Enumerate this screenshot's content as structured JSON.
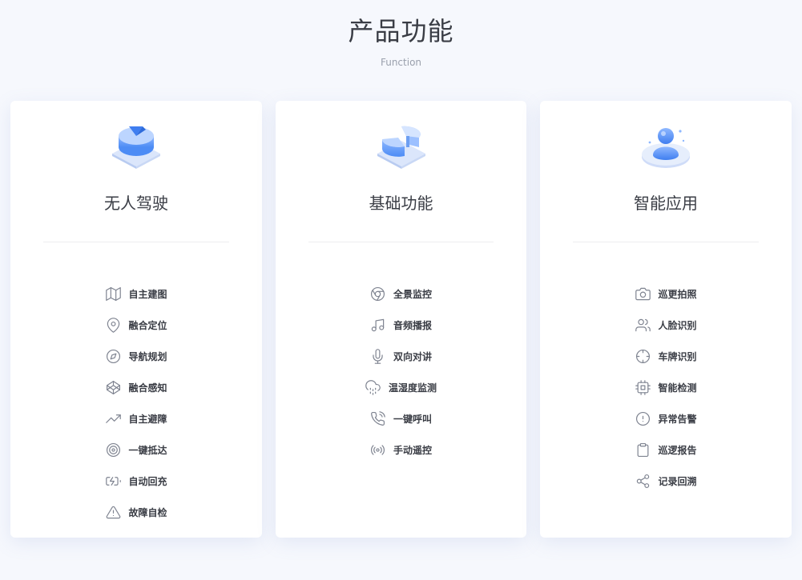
{
  "page": {
    "title": "产品功能",
    "subtitle": "Function"
  },
  "cards": [
    {
      "name": "无人驾驶",
      "icon": "isometric-cylinder-icon",
      "items": [
        {
          "label": "自主建图",
          "icon": "map-icon"
        },
        {
          "label": "融合定位",
          "icon": "location-pin-icon"
        },
        {
          "label": "导航规划",
          "icon": "compass-icon"
        },
        {
          "label": "融合感知",
          "icon": "codepen-icon"
        },
        {
          "label": "自主避障",
          "icon": "trending-up-icon"
        },
        {
          "label": "一键抵达",
          "icon": "target-icon"
        },
        {
          "label": "自动回充",
          "icon": "battery-charging-icon"
        },
        {
          "label": "故障自检",
          "icon": "warning-triangle-icon"
        }
      ]
    },
    {
      "name": "基础功能",
      "icon": "isometric-pie-chart-icon",
      "items": [
        {
          "label": "全景监控",
          "icon": "chrome-icon"
        },
        {
          "label": "音频播报",
          "icon": "music-icon"
        },
        {
          "label": "双向对讲",
          "icon": "microphone-icon"
        },
        {
          "label": "温湿度监测",
          "icon": "cloud-drizzle-icon"
        },
        {
          "label": "一键呼叫",
          "icon": "phone-call-icon"
        },
        {
          "label": "手动遥控",
          "icon": "radio-signal-icon"
        }
      ]
    },
    {
      "name": "智能应用",
      "icon": "isometric-person-icon",
      "items": [
        {
          "label": "巡更拍照",
          "icon": "camera-icon"
        },
        {
          "label": "人脸识别",
          "icon": "users-icon"
        },
        {
          "label": "车牌识别",
          "icon": "crosshair-icon"
        },
        {
          "label": "智能检测",
          "icon": "cpu-icon"
        },
        {
          "label": "异常告警",
          "icon": "alert-circle-icon"
        },
        {
          "label": "巡逻报告",
          "icon": "clipboard-icon"
        },
        {
          "label": "记录回溯",
          "icon": "share-icon"
        }
      ]
    }
  ]
}
